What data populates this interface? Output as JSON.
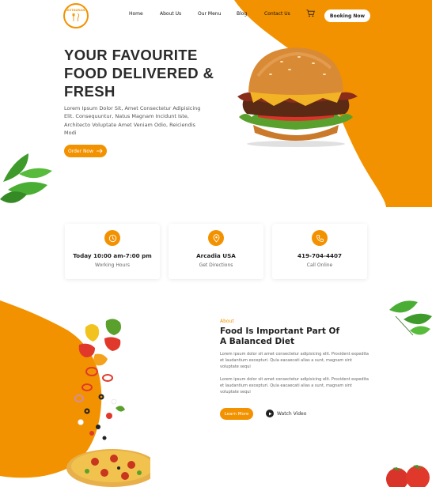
{
  "logo": {
    "text": "RESTAURANT"
  },
  "nav": {
    "items": [
      "Home",
      "About Us",
      "Our Menu",
      "Blog",
      "Contact Us"
    ],
    "booking_label": "Booking Now"
  },
  "hero": {
    "title": "YOUR FAVOURITE FOOD DELIVERED & FRESH",
    "text": "Lorem Ipsum Dolor Sit, Amet Consectetur Adipisicing Elit. Consequuntur, Natus Magnam Incidunt Iste, Architecto Voluptate Amet Veniam Odio, Reiciendis Modi",
    "order_label": "Order Now"
  },
  "cards": [
    {
      "title": "Today 10:00 am-7:00 pm",
      "sub": "Working Hours",
      "icon": "clock-icon"
    },
    {
      "title": "Arcadia USA",
      "sub": "Get Directions",
      "icon": "location-pin-icon"
    },
    {
      "title": "419-704-4407",
      "sub": "Call Online",
      "icon": "phone-icon"
    }
  ],
  "about": {
    "label": "About",
    "title": "Food Is Important Part Of A Balanced Diet",
    "p1": "Lorem ipsum dolor sit amet consectetur adipisicing elit. Provident expedita et laudantium excepturi. Quia eacaecati alias a sunt, magnam sint voluptate sequi",
    "p2": "Lorem ipsum dolor sit amet consectetur adipisicing elit. Provident expedita et laudantium excepturi. Quia eacaecati alias a sunt, magnam sint voluptate sequi",
    "learn_label": "Learn More",
    "watch_label": "Watch Video"
  },
  "colors": {
    "accent": "#f39200",
    "text": "#222222"
  }
}
